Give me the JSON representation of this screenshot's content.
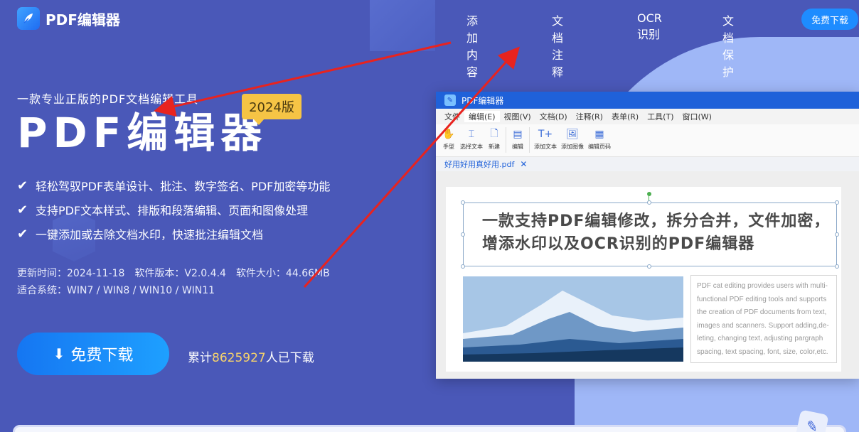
{
  "header": {
    "logo_text": "PDF编辑器",
    "nav": [
      "添加内容",
      "文档注释",
      "OCR识别",
      "文档保护"
    ],
    "download_label": "免费下载"
  },
  "hero": {
    "subtitle": "一款专业正版的PDF文档编辑工具",
    "title": "PDF编辑器",
    "badge": "2024版",
    "features": [
      "轻松驾驭PDF表单设计、批注、数字签名、PDF加密等功能",
      "支持PDF文本样式、排版和段落编辑、页面和图像处理",
      "一键添加或去除文档水印，快速批注编辑文档"
    ],
    "update_time": "更新时间：2024-11-18",
    "version": "软件版本：V2.0.4.4",
    "size": "软件大小：44.66MB",
    "systems": "适合系统：WIN7 / WIN8 / WIN10 / WIN11",
    "download_label": "免费下载",
    "counter_prefix": "累计",
    "counter_number": "8625927",
    "counter_suffix": "人已下载"
  },
  "app_window": {
    "title": "PDF编辑器",
    "menu": [
      "文件",
      "编辑(E)",
      "视图(V)",
      "文档(D)",
      "注释(R)",
      "表单(R)",
      "工具(T)",
      "窗口(W)"
    ],
    "tools": [
      "手型",
      "选择文本",
      "新建",
      "编辑",
      "添加文本",
      "添加图像",
      "编辑页码"
    ],
    "tab": "好用好用真好用.pdf",
    "headline": "一款支持PDF编辑修改，拆分合并，文件加密，增添水印以及OCR识别的PDF编辑器",
    "english_text": "PDF cat editing provides users with multi-functional PDF editing tools and supports the creation of PDF documents from text, images and scanners. Support adding,de-leting, changing text, adjusting pargraph spacing, text spacing, font, size, color,etc."
  },
  "colors": {
    "background": "#4a58b8",
    "accent": "#1e8cff",
    "badge": "#f6c445",
    "arrow": "#e8231f",
    "counter_number": "#f7d36b"
  }
}
